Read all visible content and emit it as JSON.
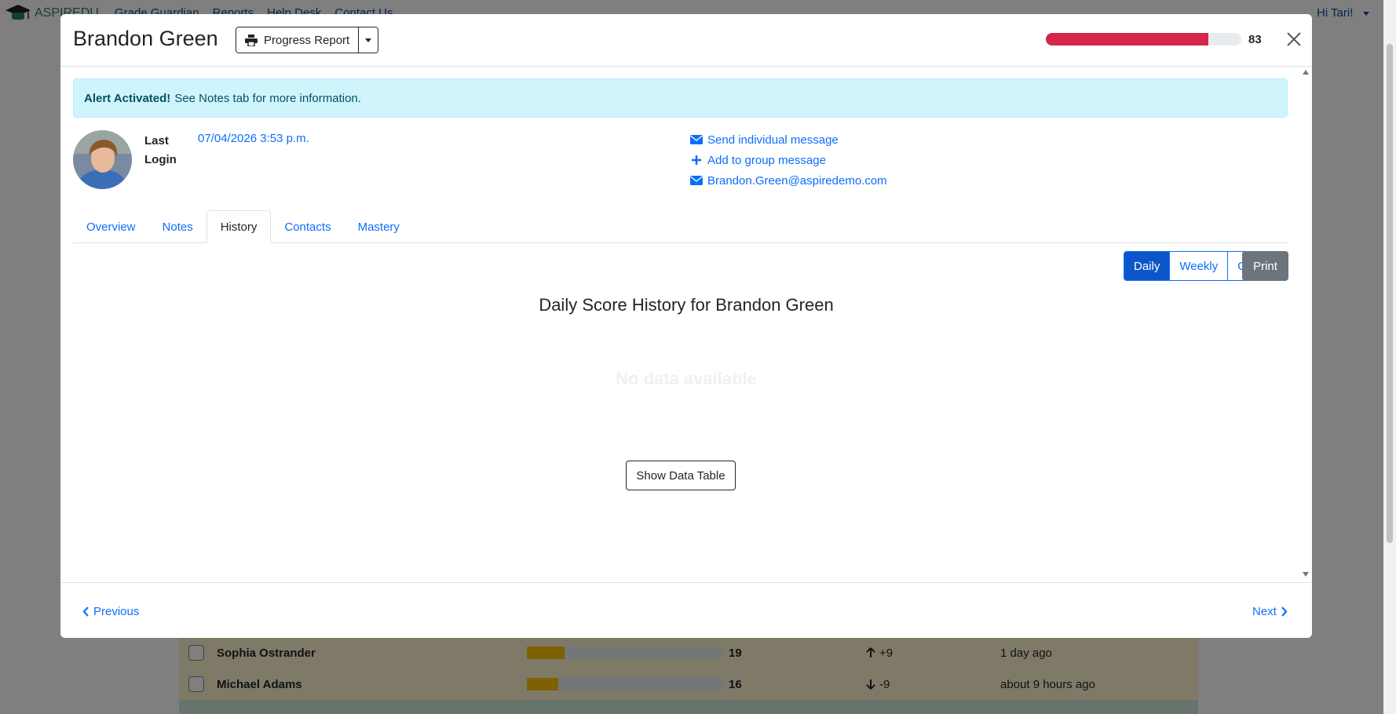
{
  "background": {
    "brand": "ASPIREDU",
    "nav_links": [
      "Grade Guardian",
      "Reports",
      "Help Desk",
      "Contact Us"
    ],
    "user_menu": "Hi Tari!",
    "rows": [
      {
        "name": "Sophia Ostrander",
        "score": "19",
        "progress": 0.19,
        "trend": "+9",
        "trend_dir": "up",
        "last_seen": "1 day ago"
      },
      {
        "name": "Michael Adams",
        "score": "16",
        "progress": 0.16,
        "trend": "-9",
        "trend_dir": "down",
        "last_seen": "about 9 hours ago"
      }
    ]
  },
  "modal": {
    "student_name": "Brandon Green",
    "report_button": "Progress Report",
    "score": "83",
    "score_fraction": 0.83,
    "score_color": "#d4264a",
    "alert": {
      "strong": "Alert Activated!",
      "text": "See Notes tab for more information."
    },
    "last_login_label": "Last Login",
    "last_login_value": "07/04/2026 3:53 p.m.",
    "contact_links": {
      "send_individual": "Send individual message",
      "add_group": "Add to group message",
      "email": "Brandon.Green@aspiredemo.com"
    },
    "tabs": [
      "Overview",
      "Notes",
      "History",
      "Contacts",
      "Mastery"
    ],
    "active_tab": "History",
    "view_buttons": [
      "Daily",
      "Weekly",
      "Grades"
    ],
    "active_view": "Daily",
    "print_label": "Print",
    "chart_title": "Daily Score History for Brandon Green",
    "no_data": "No data available",
    "show_table_label": "Show Data Table",
    "prev_label": "Previous",
    "next_label": "Next"
  },
  "colors": {
    "primary": "#0d6efd",
    "active_view": "#0d56c9",
    "alert_bg": "#cff4fc",
    "print_bg": "#6c757d"
  }
}
